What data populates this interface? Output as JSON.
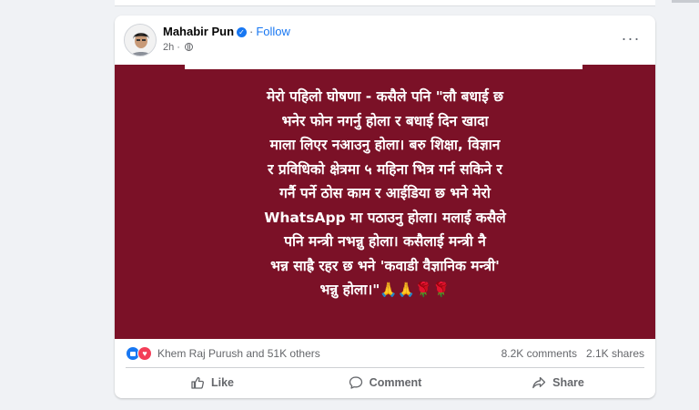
{
  "post": {
    "author": "Mahabir Pun",
    "follow_label": "Follow",
    "separator": "·",
    "time": "2h",
    "more_label": "···",
    "text": "मेरो पहिलो घोषणा - कसैले पनि \"लौ बधाई छ\nभनेर फोन नगर्नु होला र बधाई दिन खादा\nमाला लिएर नआउनु होला। बरु शिक्षा, विज्ञान\nर प्रविधिको क्षेत्रमा ५ महिना भित्र गर्न सकिने र\nगर्नै पर्ने ठोस काम र आईडिया छ भने मेरो\nWhatsApp मा पठाउनु होला। मलाई कसैले\nपनि मन्त्री नभन्नु होला। कसैलाई मन्त्री नै\nभन्न साह्रै रहर छ भने 'कवाडी वैज्ञानिक मन्त्री'\nभन्नु होला।\"🙏🙏🌹🌹",
    "background_color": "#7b1127"
  },
  "engagement": {
    "reactors": "Khem Raj Purush and 51K others",
    "comments": "8.2K comments",
    "shares": "2.1K shares"
  },
  "actions": {
    "like": "Like",
    "comment": "Comment",
    "share": "Share"
  },
  "icons": [
    "verified-icon",
    "globe-icon",
    "more-icon",
    "like-reaction-icon",
    "love-reaction-icon",
    "thumbs-up-icon",
    "comment-icon",
    "share-icon"
  ],
  "colors": {
    "accent": "#1877f2",
    "love": "#f33e58",
    "muted": "#65676b"
  }
}
